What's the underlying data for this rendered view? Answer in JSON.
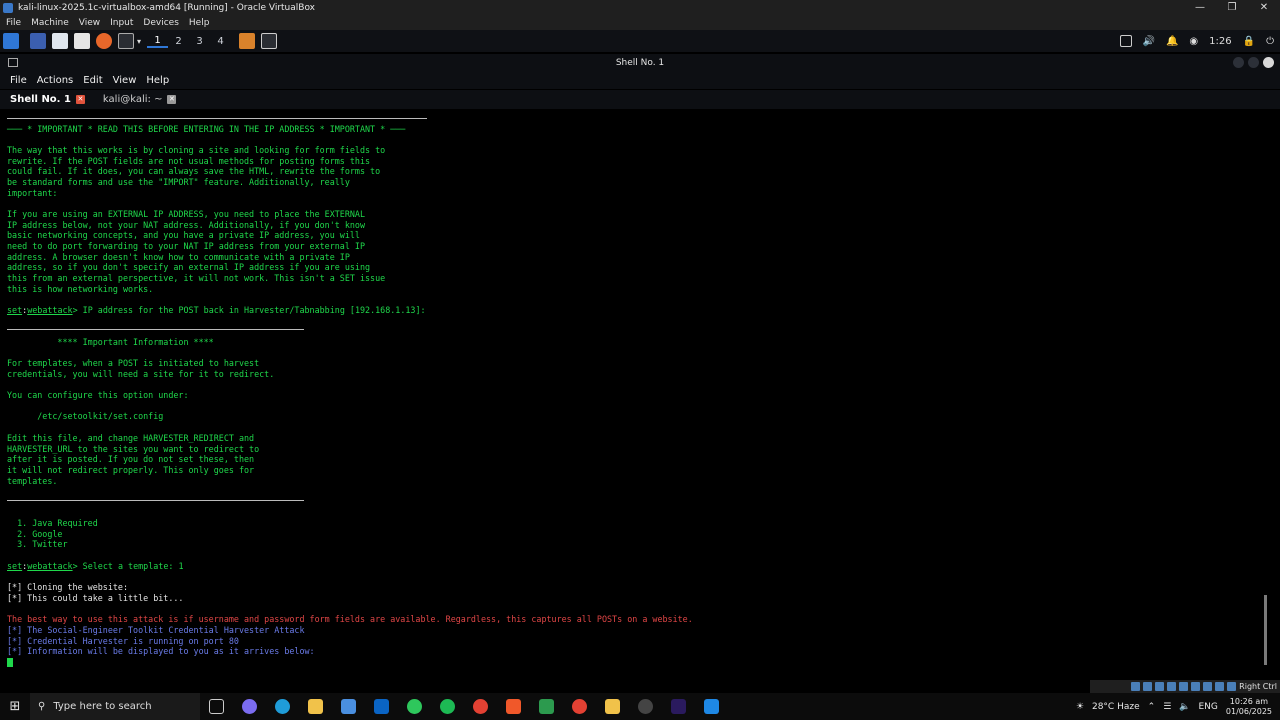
{
  "vbox": {
    "title": "kali-linux-2025.1c-virtualbox-amd64 [Running] - Oracle VirtualBox",
    "controls": [
      "—",
      "❐",
      "✕"
    ],
    "menu": [
      "File",
      "Machine",
      "View",
      "Input",
      "Devices",
      "Help"
    ],
    "host_key": "Right Ctrl"
  },
  "kali_panel": {
    "workspaces": [
      "1",
      "2",
      "3",
      "4"
    ],
    "active_workspace": "1",
    "time": "1:26"
  },
  "terminal": {
    "window_title": "Shell No. 1",
    "menu": [
      "File",
      "Actions",
      "Edit",
      "View",
      "Help"
    ],
    "tabs": [
      {
        "label": "Shell No. 1",
        "active": true
      },
      {
        "label": "kali@kali: ~",
        "active": false
      }
    ],
    "lines": {
      "important": "─── * IMPORTANT * READ THIS BEFORE ENTERING IN THE IP ADDRESS * IMPORTANT * ───",
      "p1_1": "The way that this works is by cloning a site and looking for form fields to",
      "p1_2": "rewrite. If the POST fields are not usual methods for posting forms this",
      "p1_3": "could fail. If it does, you can always save the HTML, rewrite the forms to",
      "p1_4": "be standard forms and use the \"IMPORT\" feature. Additionally, really",
      "p1_5": "important:",
      "p2_1": "If you are using an EXTERNAL IP ADDRESS, you need to place the EXTERNAL",
      "p2_2": "IP address below, not your NAT address. Additionally, if you don't know",
      "p2_3": "basic networking concepts, and you have a private IP address, you will",
      "p2_4": "need to do port forwarding to your NAT IP address from your external IP",
      "p2_5": "address. A browser doesn't know how to communicate with a private IP",
      "p2_6": "address, so if you don't specify an external IP address if you are using",
      "p2_7": "this from an external perspective, it will not work. This isn't a SET issue",
      "p2_8": "this is how networking works.",
      "prompt_set": "set",
      "prompt_mod": "webattack",
      "prompt1_rest": "> IP address for the POST back in Harvester/Tabnabbing [192.168.1.13]:",
      "info_header": "          **** Important Information ****",
      "p3_1": "For templates, when a POST is initiated to harvest",
      "p3_2": "credentials, you will need a site for it to redirect.",
      "p4_1": "You can configure this option under:",
      "p4_2": "      /etc/setoolkit/set.config",
      "p5_1": "Edit this file, and change HARVESTER_REDIRECT and",
      "p5_2": "HARVESTER_URL to the sites you want to redirect to",
      "p5_3": "after it is posted. If you do not set these, then",
      "p5_4": "it will not redirect properly. This only goes for",
      "p5_5": "templates.",
      "opt1": "  1. Java Required",
      "opt2": "  2. Google",
      "opt3": "  3. Twitter",
      "prompt2_rest": "> Select a template: 1",
      "clone1": "[*] Cloning the website:",
      "clone2": "[*] This could take a little bit...",
      "warn": "The best way to use this attack is if username and password form fields are available. Regardless, this captures all POSTs on a website.",
      "status1": "[*] The Social-Engineer Toolkit Credential Harvester Attack",
      "status2": "[*] Credential Harvester is running on port 80",
      "status3": "[*] Information will be displayed to you as it arrives below:"
    }
  },
  "taskbar": {
    "search_placeholder": "Type here to search",
    "weather": "28°C  Haze",
    "lang": "ENG",
    "time": "10:26 am",
    "date": "01/06/2025"
  },
  "colors": {
    "terminal_green": "#1fd84b",
    "warning_red": "#e04646",
    "status_blue": "#6a7be8",
    "accent": "#2f77d6"
  }
}
